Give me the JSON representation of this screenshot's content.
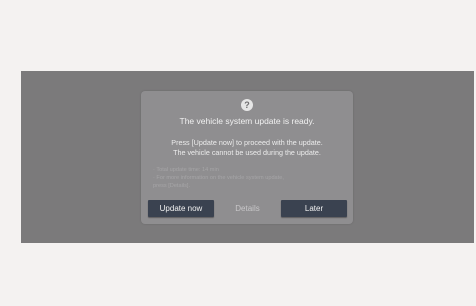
{
  "dialog": {
    "icon": "question-icon",
    "icon_glyph": "?",
    "title": "The vehicle system update is ready.",
    "body_lines": [
      "Press [Update now] to proceed with the update.",
      "The vehicle cannot be used during the update."
    ],
    "notes": [
      "· Total update time: 14 min",
      "· For more information on the vehicle system update,",
      "  press [Details]."
    ],
    "buttons": {
      "update_now": "Update now",
      "details": "Details",
      "later": "Later"
    }
  },
  "colors": {
    "page_background": "#f4f2f1",
    "screen_dim": "#7b7a7b",
    "dialog_background": "#8f8e90",
    "button_primary": "#3a4250"
  }
}
